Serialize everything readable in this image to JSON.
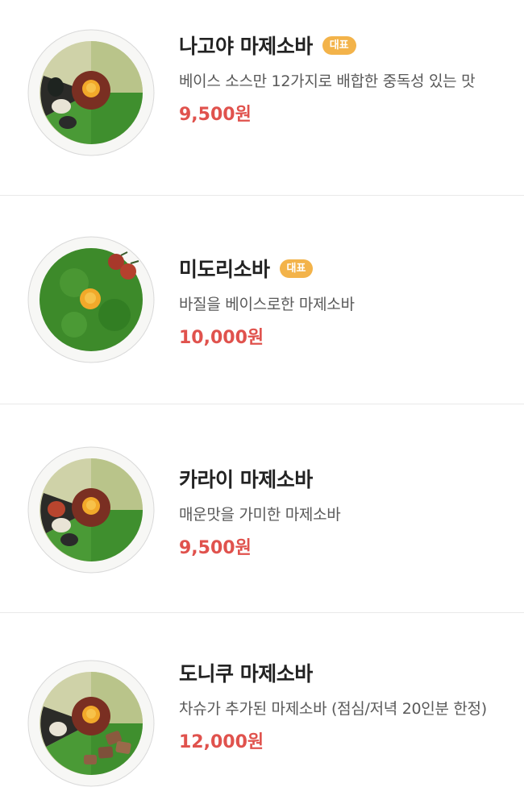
{
  "colors": {
    "price": "#e0524d",
    "badge_bg": "#f3b34a",
    "name": "#222222",
    "description": "#595959",
    "divider": "#e9e9e9"
  },
  "menu": {
    "items": [
      {
        "name": "나고야 마제소바",
        "badge": "대표",
        "description": "베이스 소스만 12가지로 배합한 중독성 있는 맛",
        "price": "9,500원",
        "image": "nagoya-mazesoba-bowl-image"
      },
      {
        "name": "미도리소바",
        "badge": "대표",
        "description": "바질을 베이스로한 마제소바",
        "price": "10,000원",
        "image": "midori-soba-bowl-image"
      },
      {
        "name": "카라이 마제소바",
        "description": "매운맛을 가미한 마제소바",
        "price": "9,500원",
        "image": "karai-mazesoba-bowl-image"
      },
      {
        "name": "도니쿠 마제소바",
        "description": "차슈가 추가된 마제소바 (점심/저녁 20인분 한정)",
        "price": "12,000원",
        "image": "doniku-mazesoba-bowl-image"
      }
    ]
  }
}
